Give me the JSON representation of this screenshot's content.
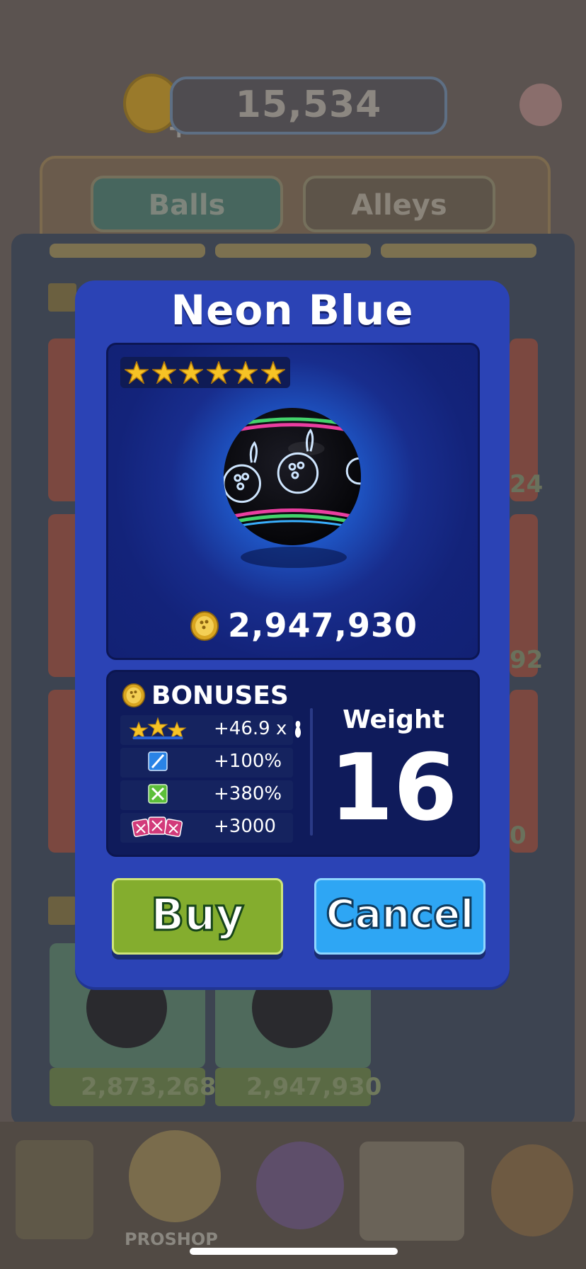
{
  "background": {
    "balance": "15,534",
    "tabs": [
      "Balls",
      "Alleys"
    ],
    "card_prices": [
      "2,873,268",
      "2,947,930"
    ],
    "side_prices_right": [
      "24",
      "92",
      "0"
    ],
    "nav": {
      "proshop_label": "PROSHOP"
    }
  },
  "modal": {
    "title": "Neon Blue",
    "star_count": 6,
    "price": "2,947,930",
    "bonuses": {
      "title": "BONUSES",
      "rows": [
        {
          "icon": "three-stars-icon",
          "value": "+46.9 x"
        },
        {
          "icon": "spare-icon",
          "value": "+100%"
        },
        {
          "icon": "strike-icon",
          "value": "+380%"
        },
        {
          "icon": "triple-strike-icon",
          "value": "+3000"
        }
      ]
    },
    "weight": {
      "label": "Weight",
      "value": "16"
    },
    "buttons": {
      "buy": "Buy",
      "cancel": "Cancel"
    }
  },
  "colors": {
    "modal_bg": "#2b43b5",
    "buy_green": "#84ad2e",
    "cancel_blue": "#2ea6f4",
    "star_gold": "#f7c325"
  }
}
